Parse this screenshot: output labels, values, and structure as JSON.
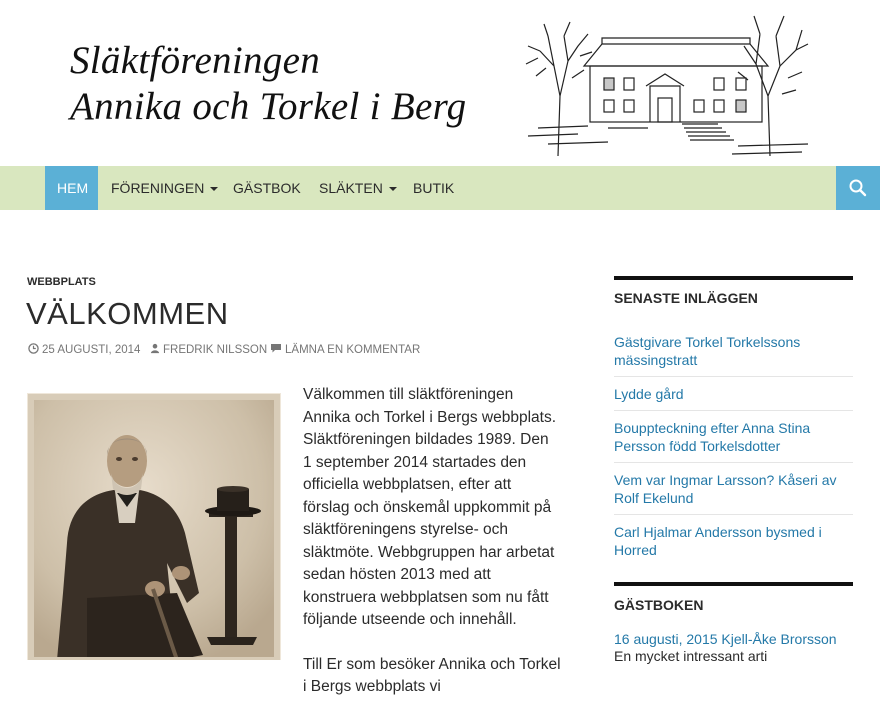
{
  "header": {
    "title_line1": "Släktföreningen",
    "title_line2": "Annika och Torkel i Berg"
  },
  "nav": {
    "items": [
      {
        "label": "Hem",
        "dropdown": false,
        "active": true
      },
      {
        "label": "Föreningen",
        "dropdown": true,
        "active": false
      },
      {
        "label": "Gästbok",
        "dropdown": false,
        "active": false
      },
      {
        "label": "Släkten",
        "dropdown": true,
        "active": false
      },
      {
        "label": "Butik",
        "dropdown": false,
        "active": false
      }
    ],
    "search_icon": "search-icon"
  },
  "post": {
    "category": "Webbplats",
    "title": "VÄLKOMMEN",
    "date": "25 augusti, 2014",
    "author": "Fredrik Nilsson",
    "comment_link": "Lämna en kommentar",
    "paragraphs": [
      "Välkommen till släktföreningen Annika och Torkel i Bergs webbplats. Släktföreningen bildades 1989. Den 1 september 2014 startades den officiella webbplatsen, efter att förslag och önskemål uppkommit på släktföreningens styrelse- och släktmöte. Webbgruppen har arbetat sedan hösten 2013 med att konstruera webbplatsen som nu fått följande utseende och innehåll.",
      "Till Er som besöker Annika och Torkel i Bergs webbplats vi"
    ]
  },
  "sidebar": {
    "recent_title": "Senaste inläggen",
    "recent_posts": [
      "Gästgivare Torkel Torkelssons mässingstratt",
      "Lydde gård",
      "Bouppteckning efter Anna Stina Persson född Torkelsdotter",
      "Vem var Ingmar Larsson? Kåseri av Rolf Ekelund",
      "Carl Hjalmar Andersson bysmed i Horred"
    ],
    "guestbook_title": "Gästboken",
    "guestbook_entry_link": "16 augusti, 2015 Kjell-Åke Brorsson",
    "guestbook_entry_excerpt": "En mycket intressant arti"
  },
  "colors": {
    "nav_bg": "#d9e7bf",
    "accent": "#5bb0d6",
    "link": "#2479a8"
  }
}
